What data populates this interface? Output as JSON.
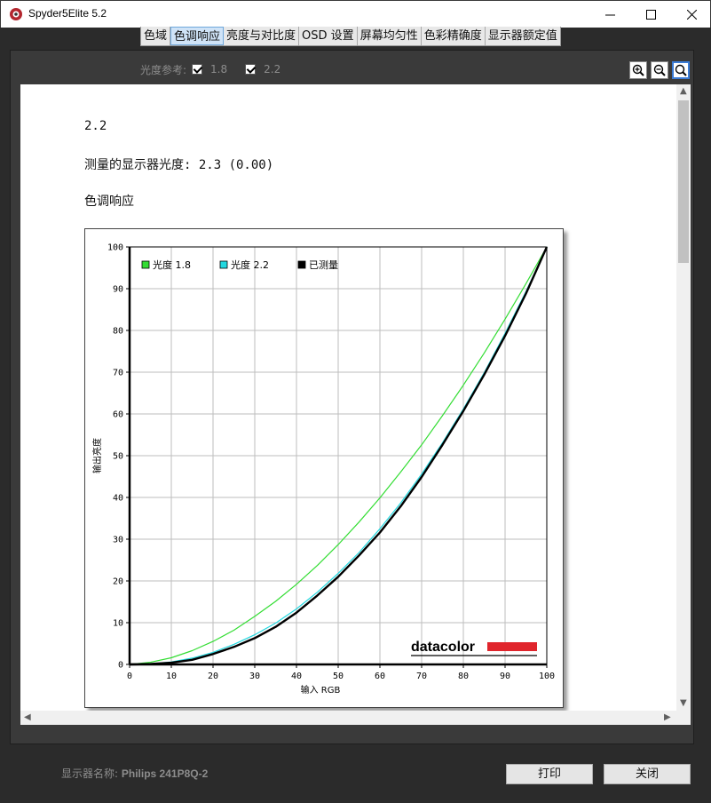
{
  "window": {
    "title": "Spyder5Elite 5.2"
  },
  "tabs": [
    {
      "label": "色域",
      "active": false
    },
    {
      "label": "色调响应",
      "active": true
    },
    {
      "label": "亮度与对比度",
      "active": false
    },
    {
      "label": "OSD 设置",
      "active": false
    },
    {
      "label": "屏幕均匀性",
      "active": false
    },
    {
      "label": "色彩精确度",
      "active": false
    },
    {
      "label": "显示器额定值",
      "active": false
    }
  ],
  "gamma_reference": {
    "label": "光度参考:",
    "options": [
      {
        "label": "1.8",
        "checked": true
      },
      {
        "label": "2.2",
        "checked": true
      }
    ]
  },
  "zoom_tools": [
    "zoom-in-icon",
    "zoom-out-icon",
    "zoom-fit-icon"
  ],
  "report": {
    "gamma_value": "2.2",
    "measured_line": "测量的显示器光度: 2.3 (0.00)",
    "section_title": "色调响应"
  },
  "chart_data": {
    "type": "line",
    "xlabel": "输入 RGB",
    "ylabel": "输出亮度",
    "xlim": [
      0,
      100
    ],
    "ylim": [
      0,
      100
    ],
    "xticks": [
      "0",
      "10",
      "20",
      "30",
      "40",
      "50",
      "60",
      "70",
      "80",
      "90",
      "100"
    ],
    "yticks": [
      "0",
      "10",
      "20",
      "30",
      "40",
      "50",
      "60",
      "70",
      "80",
      "90",
      "100"
    ],
    "grid": true,
    "legend_position": "top-left",
    "brand_logo": "datacolor",
    "x": [
      0,
      5,
      10,
      15,
      20,
      25,
      30,
      35,
      40,
      45,
      50,
      55,
      60,
      65,
      70,
      75,
      80,
      85,
      90,
      95,
      100
    ],
    "series": [
      {
        "name": "光度 1.8",
        "color": "#33dd33",
        "values": [
          0,
          0.5,
          1.6,
          3.3,
          5.5,
          8.2,
          11.5,
          15.1,
          19.2,
          23.7,
          28.7,
          34.1,
          39.9,
          46.1,
          52.6,
          59.6,
          66.9,
          74.6,
          82.7,
          91.2,
          100
        ]
      },
      {
        "name": "光度 2.2",
        "color": "#22d8e0",
        "values": [
          0,
          0.1,
          0.6,
          1.5,
          2.9,
          4.8,
          7.1,
          9.9,
          13.3,
          17.3,
          21.8,
          26.8,
          32.5,
          38.7,
          45.6,
          53.1,
          61.2,
          69.9,
          79.3,
          89.3,
          100
        ]
      },
      {
        "name": "已测量",
        "color": "#000000",
        "values": [
          0,
          0.1,
          0.4,
          1.1,
          2.5,
          4.2,
          6.3,
          9.0,
          12.4,
          16.5,
          21.0,
          26.1,
          31.6,
          37.9,
          44.9,
          52.6,
          60.7,
          69.4,
          78.7,
          88.8,
          100
        ]
      }
    ]
  },
  "footer": {
    "monitor_label": "显示器名称:",
    "monitor_name": "Philips 241P8Q-2",
    "print_label": "打印",
    "close_label": "关闭"
  },
  "colors": {
    "tab_active": "#cfe3f7",
    "brand_red": "#e0252c"
  }
}
